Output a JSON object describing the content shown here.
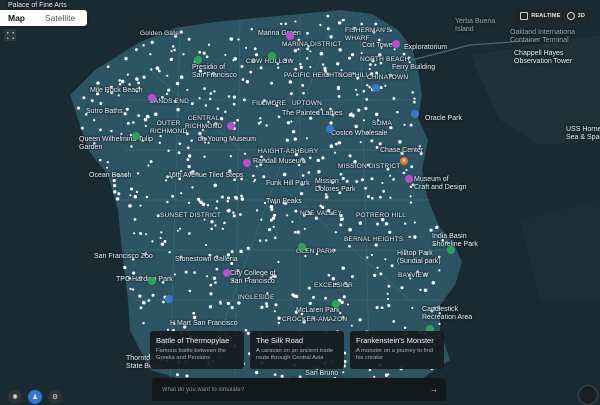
{
  "map": {
    "colors": {
      "water": "#1a2a33",
      "land": "#2d5462",
      "road": "#3c6675",
      "dot": "#ffffff"
    },
    "labels": {
      "fine_arts": "Palace of Fine Arts",
      "golden_gate": "Golden Gate",
      "marina_green": "Marina Green",
      "marina_district": "MARINA DISTRICT",
      "fishermans_wharf": "FISHERMAN'S\nWHARF",
      "coit_tower": "Coit Tower",
      "exploratorium": "Exploratorium",
      "yerba_buena": "Yerba Buena\nIsland",
      "oakland_terminal": "Oakland Internationa\nContainer Terminal",
      "chappell_hayes": "Chappell Hayes\nObservation Tower",
      "presidio": "Presidio of\nSan Francisco",
      "cow_hollow": "COW HOLLOW",
      "pacific_heights": "PACIFIC HEIGHTS",
      "nob_hill": "NOB HILL",
      "chinatown": "CHINATOWN",
      "ferry_building": "Ferry Building",
      "north_beach": "NORTH BEACH",
      "mile_rock": "Mile Rock Beach",
      "sutro_baths": "Sutro Baths",
      "lands_end": "LANDS END",
      "uptown": "UPTOWN",
      "fillmore": "FILLMORE",
      "painted_ladies": "The Painted Ladies",
      "oracle_park": "Oracle Park",
      "queen_wilhelmina": "Queen Wilhelmina Tulip\nGarden",
      "outer_richmond": "OUTER\nRICHMOND",
      "central_richmond": "CENTRAL\nRICHMOND",
      "young_museum": "de Young Museum",
      "haight": "HAIGHT-ASHBURY",
      "costco": "Costco Wholesale",
      "soma": "SOMA",
      "uss_hornet": "USS Hornet\nSea & Space",
      "chase_center": "Chase Center",
      "randall": "Randall Museum",
      "mission_district": "MISSION DISTRICT",
      "museum_craft": "Museum of\nCraft and Design",
      "ocean_beach": "Ocean Beach",
      "tiled_steps": "16th Avenue Tiled Steps",
      "sunset": "SUNSET DISTRICT",
      "funk_hill": "Funk Hill Park",
      "mission_dolores": "Mission\nDolores Park",
      "twin_peaks": "Twin Peaks",
      "noe_valley": "NOE VALLEY",
      "potrero": "POTRERO HILL",
      "sf_zoo": "San Francisco Zoo",
      "stonestown": "Stonestown Galleria",
      "glen_park": "GLEN PARK",
      "bernal": "BERNAL HEIGHTS",
      "india_basin": "India Basin\nShoreline Park",
      "hilltop": "Hilltop Park\n(Sundial park)",
      "tpc": "TPC Harding Park",
      "city_college": "City College of\nSan Francisco",
      "ingleside": "INGLESIDE",
      "excelsior": "EXCELSIOR",
      "bayview": "BAYVIEW",
      "mclaren": "McLaren Park",
      "hmart": "H Mart San Francisco",
      "crocker": "CROCKER-AMAZON",
      "candlestick": "Candlestick\nRecreation Area",
      "state_beach": "Thornton\nState Beach",
      "county_park": "San Bruno\nState & County Park"
    }
  },
  "view_tabs": {
    "map": "Map",
    "satellite": "Satellite"
  },
  "topbar": {
    "realtime": "REALTIME",
    "three_d": "3D"
  },
  "cards": [
    {
      "title": "Battle of Thermopylae",
      "desc": "Famous battle between the Greeks and Persians"
    },
    {
      "title": "The Silk Road",
      "desc": "A caravan on an ancient trade route through Central Asia"
    },
    {
      "title": "Frankenstein's Monster",
      "desc": "A monster on a journey to find his creator"
    }
  ],
  "prompt": {
    "placeholder": "What do you want to simulate?"
  }
}
